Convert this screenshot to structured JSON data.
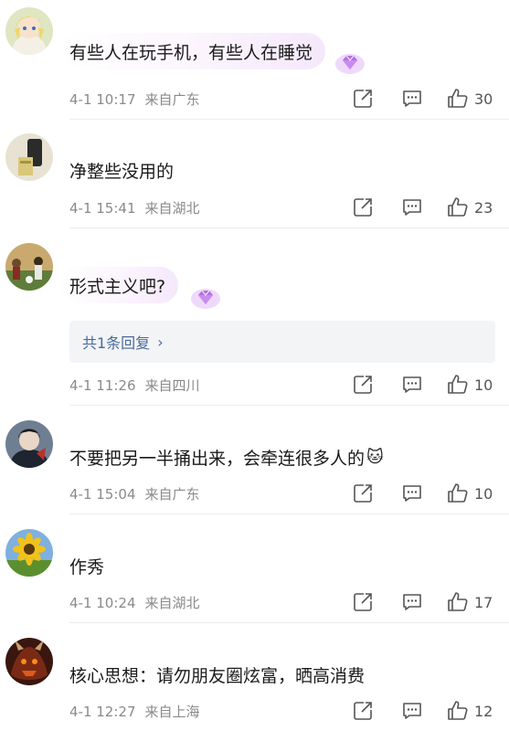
{
  "comments": [
    {
      "text": "有些人在玩手机，有些人在睡觉",
      "date": "4-1 10:17",
      "location": "来自广东",
      "likes": "30",
      "fan_badge": true
    },
    {
      "text": "净整些没用的",
      "date": "4-1 15:41",
      "location": "来自湖北",
      "likes": "23",
      "fan_badge": false
    },
    {
      "text": "形式主义吧?",
      "date": "4-1 11:26",
      "location": "来自四川",
      "likes": "10",
      "fan_badge": true,
      "replies_label": "共1条回复",
      "replies_chevron": "›"
    },
    {
      "text": "不要把另一半捅出来，会牵连很多人的",
      "emoji": "🐱",
      "date": "4-1 15:04",
      "location": "来自广东",
      "likes": "10",
      "fan_badge": false
    },
    {
      "text": "作秀",
      "date": "4-1 10:24",
      "location": "来自湖北",
      "likes": "17",
      "fan_badge": false
    },
    {
      "text": "核心思想：请勿朋友圈炫富，晒高消费",
      "date": "4-1 12:27",
      "location": "来自上海",
      "likes": "12",
      "fan_badge": false
    }
  ],
  "icons": {
    "share": "share-icon",
    "reply": "comment-icon",
    "like": "thumbs-up-icon",
    "badge": "fan-diamond-badge-icon"
  },
  "colors": {
    "meta_text": "#8a8a8a",
    "reply_link": "#4a6a9c",
    "badge_purple": "#b36ee0"
  }
}
